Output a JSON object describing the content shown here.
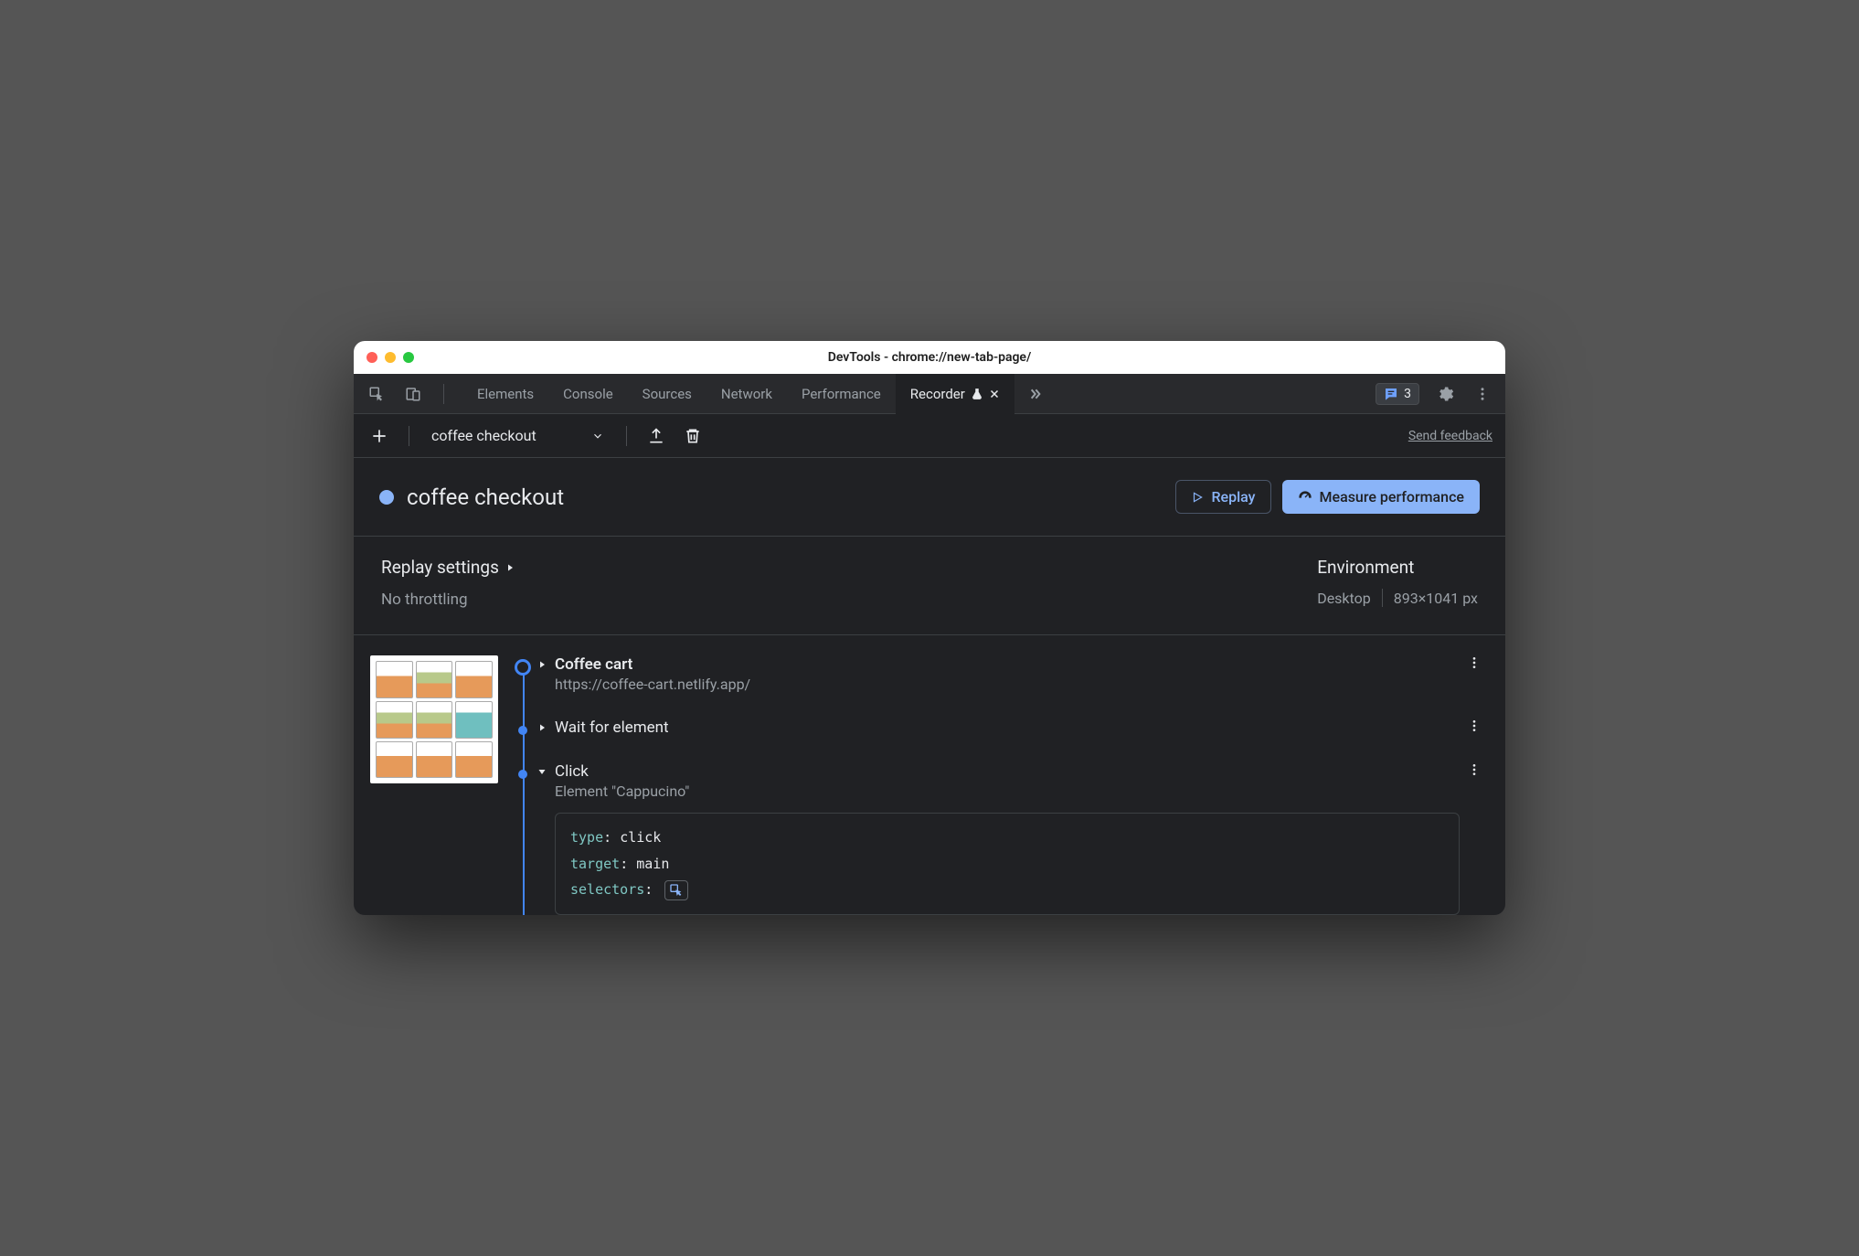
{
  "window": {
    "title": "DevTools - chrome://new-tab-page/"
  },
  "tabs": {
    "elements": "Elements",
    "console": "Console",
    "sources": "Sources",
    "network": "Network",
    "performance": "Performance",
    "recorder": "Recorder"
  },
  "issues_count": "3",
  "toolbar": {
    "recording_name": "coffee checkout",
    "feedback": "Send feedback"
  },
  "recording": {
    "title": "coffee checkout",
    "replay_label": "Replay",
    "measure_label": "Measure performance"
  },
  "settings": {
    "replay_heading": "Replay settings",
    "throttle": "No throttling",
    "env_heading": "Environment",
    "device": "Desktop",
    "dimensions": "893×1041 px"
  },
  "steps": {
    "s1_title": "Coffee cart",
    "s1_url": "https://coffee-cart.netlify.app/",
    "s2_title": "Wait for element",
    "s3_title": "Click",
    "s3_sub": "Element \"Cappucino\"",
    "code": {
      "type_k": "type",
      "type_v": "click",
      "target_k": "target",
      "target_v": "main",
      "selectors_k": "selectors"
    }
  }
}
